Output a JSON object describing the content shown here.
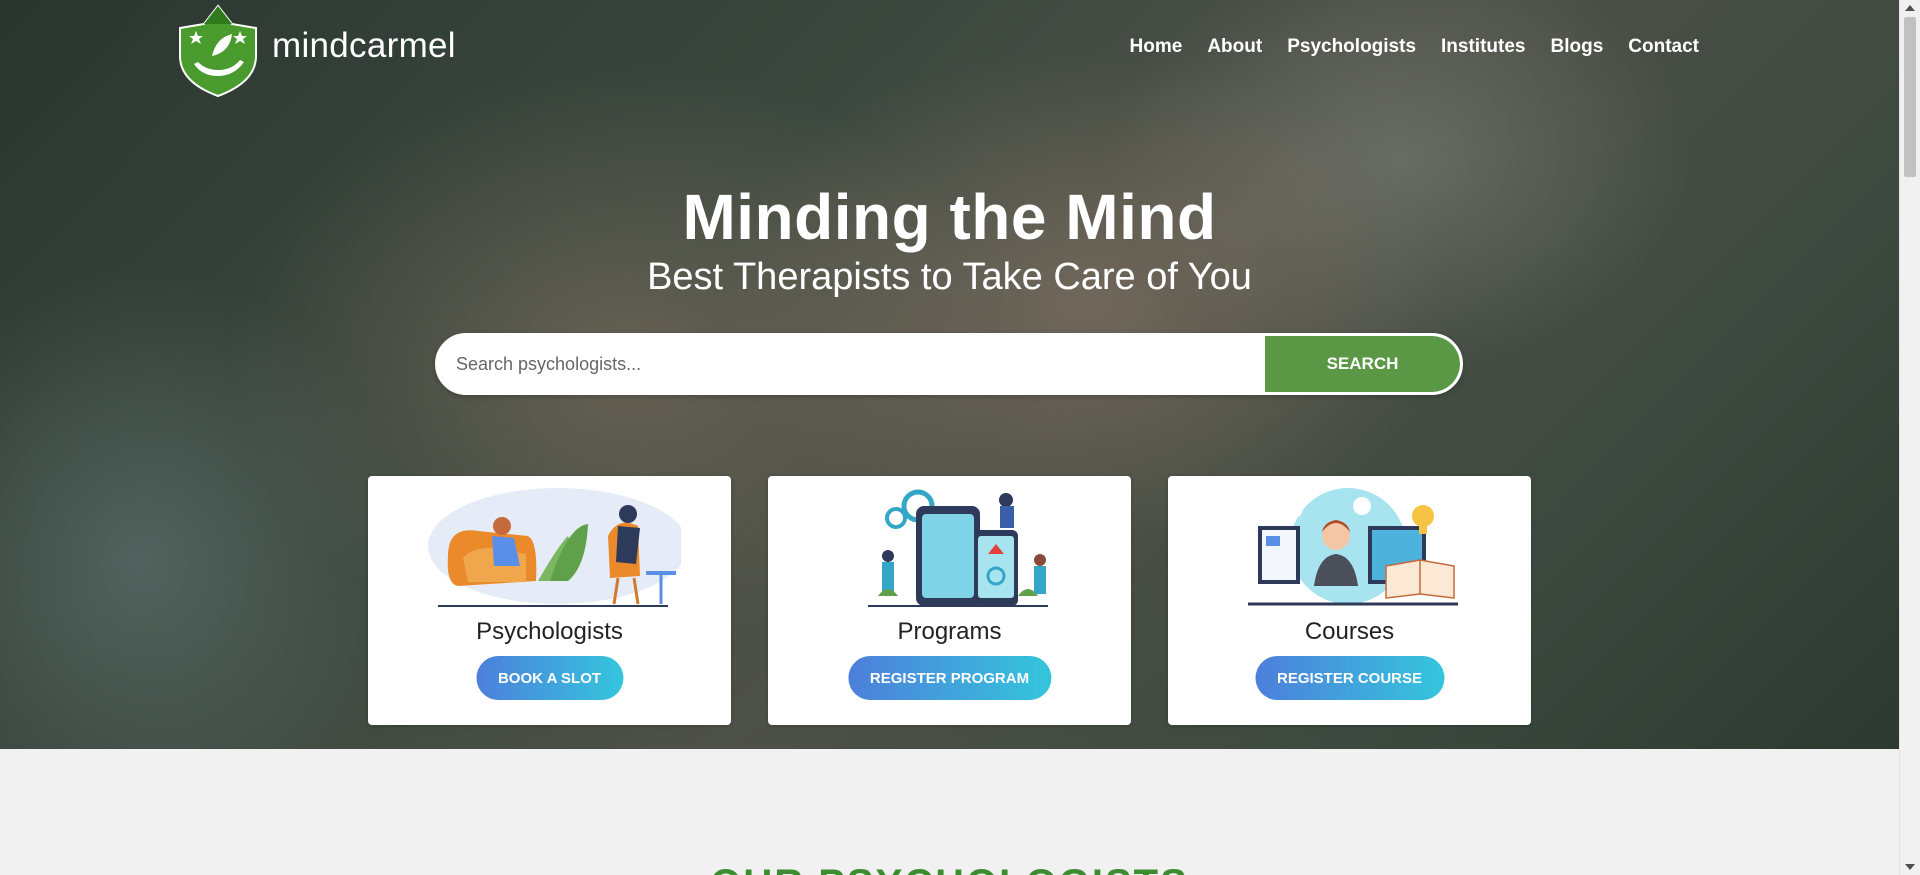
{
  "brand": {
    "name": "mindcarmel",
    "logo_icon": "leaf-hand-shield-icon",
    "logo_color": "#4a9b2e"
  },
  "nav": {
    "items": [
      {
        "label": "Home"
      },
      {
        "label": "About"
      },
      {
        "label": "Psychologists"
      },
      {
        "label": "Institutes"
      },
      {
        "label": "Blogs"
      },
      {
        "label": "Contact"
      }
    ]
  },
  "hero": {
    "title": "Minding the Mind",
    "subtitle": "Best Therapists to Take Care of You"
  },
  "search": {
    "placeholder": "Search psychologists...",
    "value": "",
    "button_label": "SEARCH",
    "button_color": "#5a9845"
  },
  "cards": [
    {
      "title": "Psychologists",
      "button_label": "BOOK A SLOT",
      "illustration": "therapy-session-illustration"
    },
    {
      "title": "Programs",
      "button_label": "REGISTER PROGRAM",
      "illustration": "mobile-app-illustration"
    },
    {
      "title": "Courses",
      "button_label": "REGISTER COURSE",
      "illustration": "online-course-illustration"
    }
  ],
  "section": {
    "title": "OUR PSYCHOLOGISTS",
    "title_color": "#3c8c30"
  },
  "colors": {
    "button_gradient_start": "#4d7fdb",
    "button_gradient_end": "#34c6dc"
  }
}
